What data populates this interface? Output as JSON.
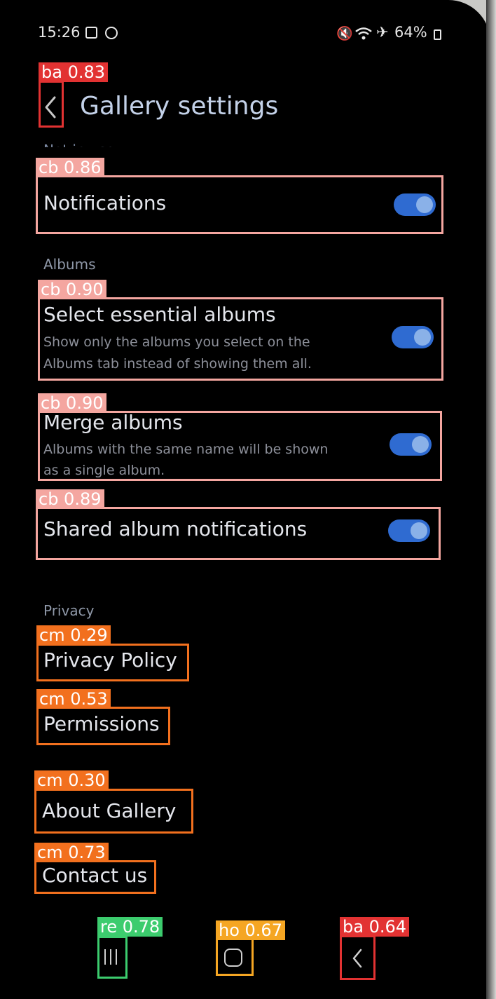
{
  "status_bar": {
    "time": "15:26",
    "battery": "64%",
    "icons_left": [
      "checkbox-icon",
      "circle-icon"
    ],
    "icons_right": [
      "mute-icon",
      "wifi-icon",
      "airplane-icon",
      "battery-icon"
    ]
  },
  "header": {
    "title": "Gallery settings",
    "partial_text": "Not in use"
  },
  "settings": {
    "notifications": {
      "label": "Notifications",
      "enabled": true
    },
    "albums_header": "Albums",
    "select_essential": {
      "label": "Select essential albums",
      "desc_line1": "Show only the albums you select on the",
      "desc_line2": "Albums tab instead of showing them all.",
      "enabled": true
    },
    "merge_albums": {
      "label": "Merge albums",
      "desc_line1": "Albums with the same name will be shown",
      "desc_line2": "as a single album.",
      "enabled": true
    },
    "shared_notifications": {
      "label": "Shared album notifications",
      "enabled": true
    },
    "privacy_header": "Privacy",
    "privacy_policy": "Privacy Policy",
    "permissions": "Permissions",
    "about": "About Gallery",
    "contact": "Contact us"
  },
  "annotations": {
    "back_top": "ba 0.83",
    "notifications": "cb 0.86",
    "select_essential": "cb 0.90",
    "merge": "cb 0.90",
    "shared": "cb 0.89",
    "privacy_policy": "cm 0.29",
    "permissions": "cm 0.53",
    "about": "cm 0.30",
    "contact": "cm 0.73",
    "recents": "re 0.78",
    "home": "ho 0.67",
    "back_nav": "ba 0.64"
  },
  "colors": {
    "toggle_on": "#2f6bd1",
    "back_box": "#e23232",
    "checkbox_box": "#f4a6a0",
    "menu_box": "#f2701e",
    "recents_box": "#3ccc6e",
    "home_box": "#f5a623"
  }
}
